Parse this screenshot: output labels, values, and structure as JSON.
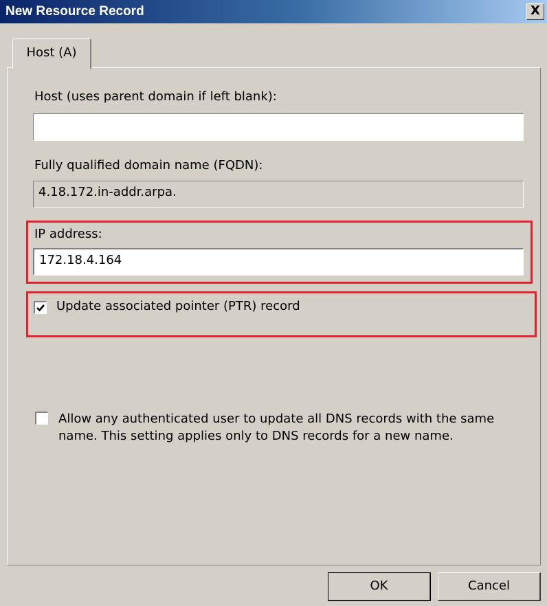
{
  "window": {
    "title": "New Resource Record",
    "close_label": "X"
  },
  "tab": {
    "label": "Host (A)"
  },
  "host": {
    "label": "Host (uses parent domain if left blank):",
    "value": ""
  },
  "fqdn": {
    "label": "Fully qualified domain name (FQDN):",
    "value": "4.18.172.in-addr.arpa."
  },
  "ip": {
    "label": "IP address:",
    "value": "172.18.4.164"
  },
  "ptr_checkbox": {
    "label": "Update associated pointer (PTR) record",
    "checked": true
  },
  "auth_checkbox": {
    "line1": "Allow any authenticated user to update all DNS records with the same",
    "line2": "name. This setting applies only to DNS records for a new name.",
    "checked": false
  },
  "buttons": {
    "ok": "OK",
    "cancel": "Cancel"
  },
  "colors": {
    "highlight": "#e2232f",
    "dialog_face": "#d4d0c8",
    "titlebar_start": "#0a246a"
  }
}
